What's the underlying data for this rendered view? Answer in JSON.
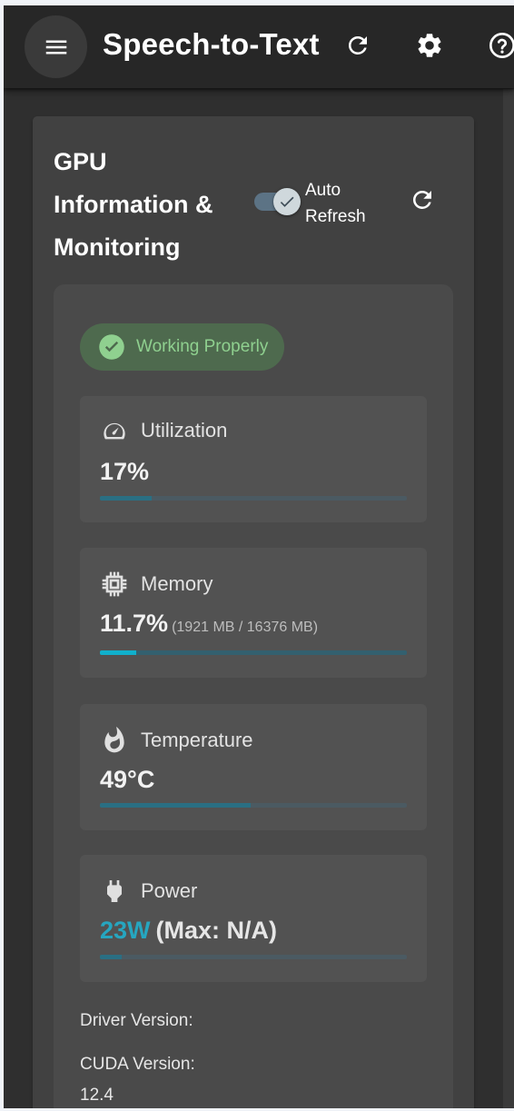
{
  "appbar": {
    "title": "Speech-to-Text",
    "icons": [
      "menu-icon",
      "refresh-icon",
      "gear-icon",
      "help-icon"
    ]
  },
  "card": {
    "title": "GPU Information & Monitoring",
    "auto_refresh_label": "Auto Refresh",
    "auto_refresh_on": true
  },
  "status": {
    "label": "Working Properly",
    "color": "#8fd08f"
  },
  "metrics": {
    "utilization": {
      "label": "Utilization",
      "value": "17%",
      "level": 0.17
    },
    "memory": {
      "label": "Memory",
      "value": "11.7%",
      "detail": "(1921 MB / 16376 MB)",
      "level": 0.117
    },
    "temperature": {
      "label": "Temperature",
      "value": "49°C",
      "level": 0.49
    },
    "power": {
      "label": "Power",
      "value": "23W",
      "max": "(Max: N/A)",
      "level": 0.07
    }
  },
  "info": {
    "driver_label": "Driver Version:",
    "cuda_label": "CUDA Version:",
    "cuda_value": "12.4"
  },
  "colors": {
    "background": "#2f2f2f",
    "card": "#414141",
    "accent": "#10b0cc",
    "success": "#8fd08f"
  }
}
